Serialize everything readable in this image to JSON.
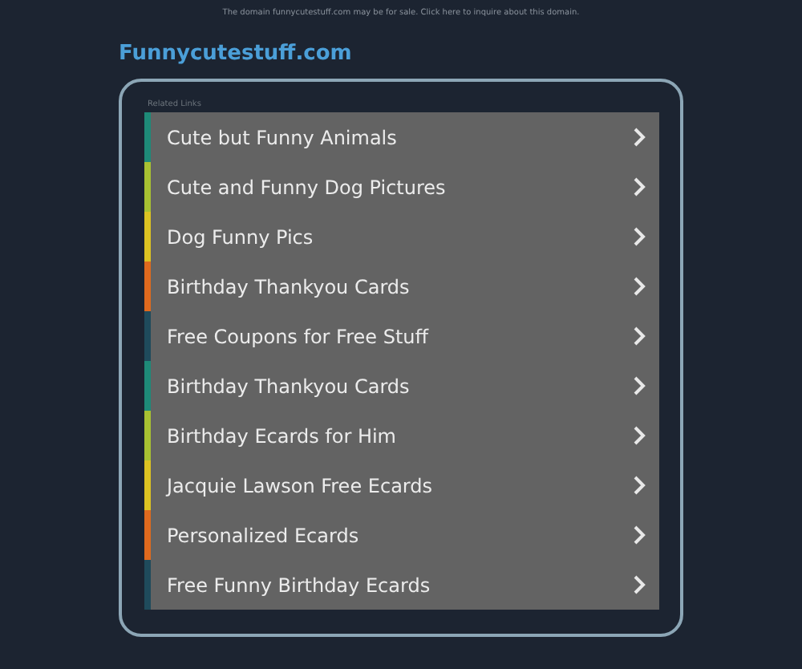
{
  "notice": "The domain funnycutestuff.com may be for sale. Click here to inquire about this domain.",
  "site_title": "Funnycutestuff.com",
  "panel": {
    "label": "Related Links",
    "links": [
      {
        "text": "Cute but Funny Animals",
        "color": "#1e8a78"
      },
      {
        "text": "Cute and Funny Dog Pictures",
        "color": "#a8c232"
      },
      {
        "text": "Dog Funny Pics",
        "color": "#dcc322"
      },
      {
        "text": "Birthday Thankyou Cards",
        "color": "#e06a1e"
      },
      {
        "text": "Free Coupons for Free Stuff",
        "color": "#1f4b5c"
      },
      {
        "text": "Birthday Thankyou Cards",
        "color": "#1e8a78"
      },
      {
        "text": "Birthday Ecards for Him",
        "color": "#a8c232"
      },
      {
        "text": "Jacquie Lawson Free Ecards",
        "color": "#dcc322"
      },
      {
        "text": "Personalized Ecards",
        "color": "#e06a1e"
      },
      {
        "text": "Free Funny Birthday Ecards",
        "color": "#1f4b5c"
      }
    ]
  }
}
